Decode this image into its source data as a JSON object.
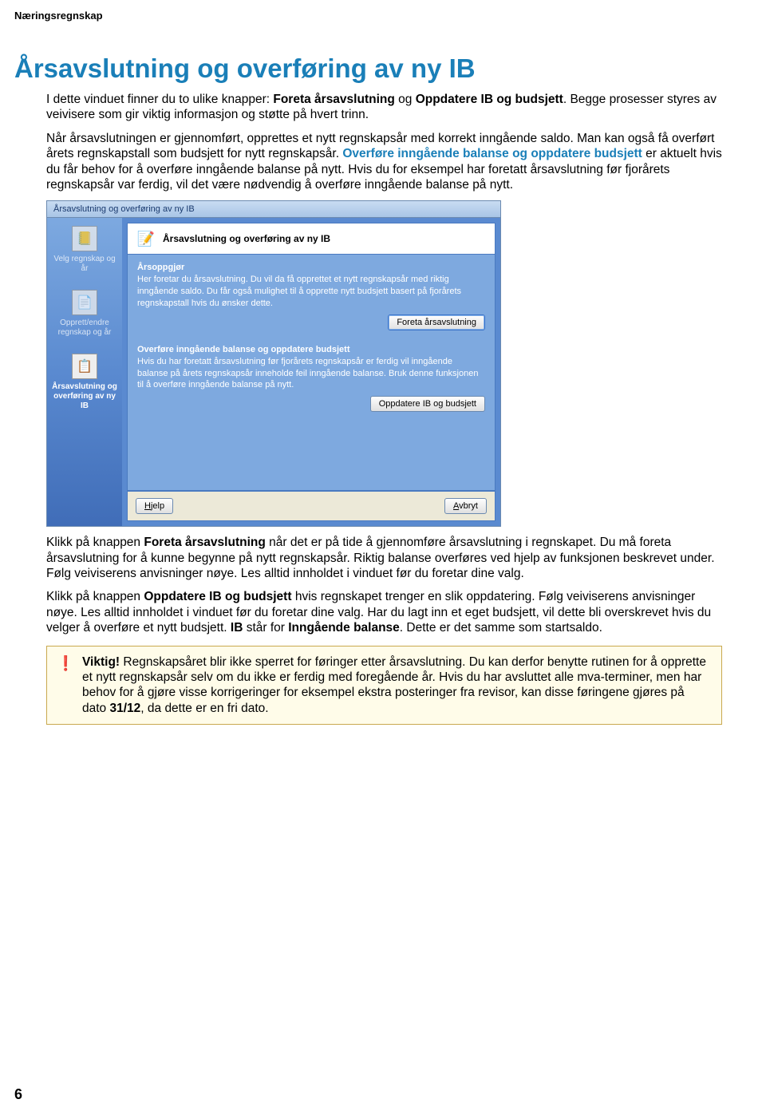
{
  "header": "Næringsregnskap",
  "title": "Årsavslutning og overføring av ny IB",
  "intro": {
    "p1_a": "I dette vinduet finner du to ulike knapper: ",
    "p1_b": "Foreta årsavslutning",
    "p1_c": " og ",
    "p1_d": "Oppdatere IB og budsjett",
    "p1_e": ". Begge prosesser styres av veivisere som gir viktig informasjon og støtte på hvert trinn.",
    "p2_a": "Når årsavslutningen er gjennomført, opprettes et nytt regnskapsår med korrekt inngående saldo. Man kan også få overført årets regnskapstall som budsjett for nytt regnskapsår. ",
    "p2_b": "Overføre inngående balanse og oppdatere budsjett",
    "p2_c": " er aktuelt hvis du får behov for å overføre inngående balanse på nytt. Hvis du for eksempel har foretatt årsavslutning før fjorårets regnskapsår var ferdig, vil det være nødvendig å overføre inngående balanse på nytt."
  },
  "wizard": {
    "titlebar": "Årsavslutning og overføring av ny IB",
    "header_title": "Årsavslutning og overføring av ny IB",
    "sidebar": {
      "item1": "Velg regnskap og år",
      "item2": "Opprett/endre regnskap og år",
      "item3": "Årsavslutning og overføring av ny IB"
    },
    "section1": {
      "title": "Årsoppgjør",
      "body": "Her foretar du årsavslutning. Du vil da få opprettet et nytt regnskapsår med riktig inngående saldo. Du får også mulighet til å opprette nytt budsjett basert på fjorårets regnskapstall hvis du ønsker dette.",
      "button": "Foreta årsavslutning"
    },
    "section2": {
      "title": "Overføre inngående balanse og oppdatere budsjett",
      "body": "Hvis du har foretatt årsavslutning før fjorårets regnskapsår er ferdig vil inngående balanse på årets regnskapsår inneholde feil inngående balanse. Bruk denne funksjonen til å overføre inngående balanse på nytt.",
      "button": "Oppdatere IB og budsjett"
    },
    "footer": {
      "help": "Hjelp",
      "cancel": "Avbryt"
    }
  },
  "body2": {
    "p1_a": "Klikk på knappen ",
    "p1_b": "Foreta årsavslutning",
    "p1_c": " når det er på tide å gjennomføre årsavslutning i regnskapet. Du må foreta årsavslutning for å kunne begynne på nytt regnskapsår. Riktig balanse overføres ved hjelp av funksjonen beskrevet under. Følg veiviserens anvisninger nøye. Les alltid innholdet i vinduet før du foretar dine valg.",
    "p2_a": "Klikk på knappen ",
    "p2_b": "Oppdatere IB og budsjett",
    "p2_c": " hvis regnskapet trenger en slik oppdatering. Følg veiviserens anvisninger nøye. Les alltid innholdet i vinduet før du foretar dine valg. Har du lagt inn et eget budsjett, vil dette bli overskrevet hvis du velger å overføre et nytt budsjett. ",
    "p2_d": "IB",
    "p2_e": " står for ",
    "p2_f": "Inngående balanse",
    "p2_g": ". Dette er det samme som startsaldo."
  },
  "warning": {
    "lead": "Viktig!",
    "text_a": " Regnskapsåret blir ikke sperret for føringer etter årsavslutning. Du kan derfor benytte rutinen for å opprette et nytt regnskapsår selv om du ikke er ferdig med foregående år. Hvis du har avsluttet alle mva-terminer, men har behov for å gjøre visse korrigeringer for eksempel ekstra posteringer fra revisor, kan disse føringene gjøres på dato ",
    "text_b": "31/12",
    "text_c": ", da dette er en fri dato."
  },
  "page_number": "6"
}
